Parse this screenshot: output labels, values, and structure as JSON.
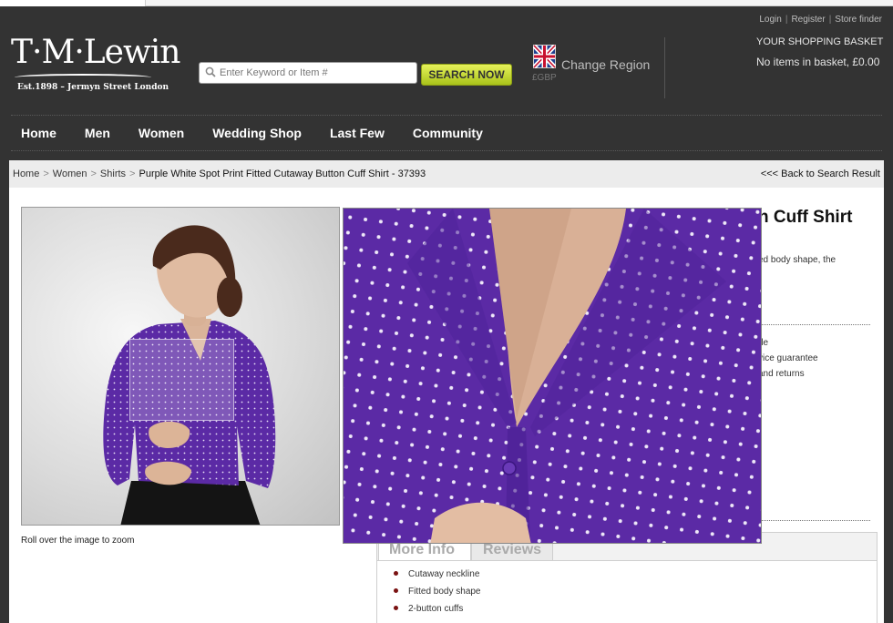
{
  "brand": {
    "logo_text": "T·M·Lewin",
    "tagline": "Est.1898 – Jermyn Street London"
  },
  "header": {
    "top_links": [
      "Login",
      "Register",
      "Store finder"
    ],
    "search": {
      "placeholder": "Enter Keyword or Item #",
      "button_label": "SEARCH NOW"
    },
    "region": {
      "label": "Change Region",
      "currency": "£GBP",
      "flag_icon": "uk-flag-icon"
    },
    "basket": {
      "title": "YOUR SHOPPING BASKET",
      "status": "No items in basket, £0.00"
    }
  },
  "nav": {
    "items": [
      "Home",
      "Men",
      "Women",
      "Wedding Shop",
      "Last Few",
      "Community"
    ]
  },
  "breadcrumb": {
    "items": [
      "Home",
      "Women",
      "Shirts"
    ],
    "current": "Purple White Spot Print Fitted Cutaway Button Cuff Shirt - 37393",
    "back_link": "<<< Back to Search Result"
  },
  "product": {
    "zoom_hint": "Roll over the image to zoom",
    "title_fragment": "n Cuff Shirt",
    "desc_fragment": "ed body shape, the",
    "feature_fragments": [
      "de",
      "vice guarantee",
      "and returns"
    ],
    "tabs": [
      "More Info",
      "Reviews"
    ],
    "features": [
      "Cutaway neckline",
      "Fitted body shape",
      "2-button cuffs"
    ]
  },
  "colors": {
    "header_bg": "#333333",
    "shirt_purple": "#5a2aa4",
    "search_button": "#c4d62a",
    "bullet": "#7a1212"
  }
}
